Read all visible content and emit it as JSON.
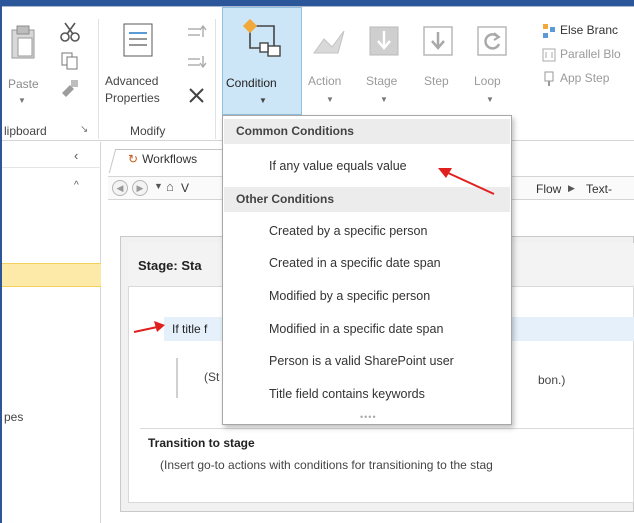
{
  "ribbon": {
    "clipboard": {
      "paste_label": "Paste",
      "group_label": "lipboard"
    },
    "modify": {
      "advanced_label_1": "Advanced",
      "advanced_label_2": "Properties",
      "group_label": "Modify"
    },
    "condition_label": "Condition",
    "action_label": "Action",
    "stage_label": "Stage",
    "step_label": "Step",
    "loop_label": "Loop",
    "else_branch_label": "Else Branc",
    "parallel_block_label": "Parallel Blo",
    "app_step_label": "App Step"
  },
  "tab": {
    "label": "Workflows"
  },
  "breadcrumb": {
    "start": "V",
    "flow": "Flow",
    "sep": "▶",
    "next": "Text-"
  },
  "stage": {
    "title": "Stage: Sta",
    "if_text": "If title f",
    "st_text": "(St",
    "bon_text": "bon.)",
    "transition_title": "Transition to stage",
    "transition_desc": "(Insert go-to actions with conditions for transitioning to the stag"
  },
  "left_pane": {
    "bottom_text": "pes"
  },
  "dropdown": {
    "common_header": "Common Conditions",
    "common_items": [
      "If any value equals value"
    ],
    "other_header": "Other Conditions",
    "other_items": [
      "Created by a specific person",
      "Created in a specific date span",
      "Modified by a specific person",
      "Modified in a specific date span",
      "Person is a valid SharePoint user",
      "Title field contains keywords"
    ]
  },
  "colors": {
    "accent": "#2b579a",
    "highlight": "#cde6f7",
    "arrow": "#e0201f",
    "yellow": "#fde9a8"
  }
}
